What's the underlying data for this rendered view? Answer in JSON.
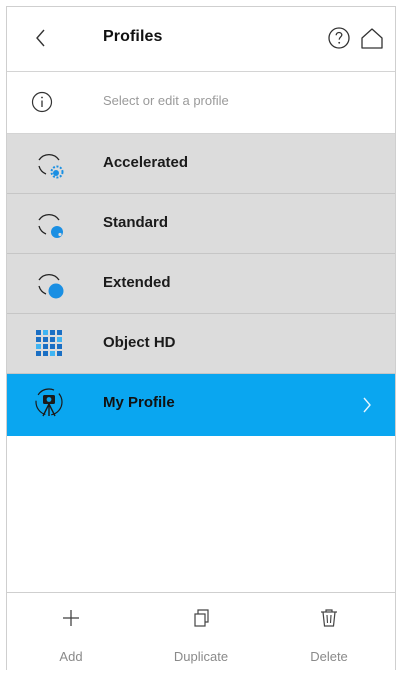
{
  "header": {
    "title": "Profiles",
    "back_icon": "chevron-left-icon",
    "help_icon": "help-circle-icon",
    "home_icon": "home-icon"
  },
  "info": {
    "icon": "info-icon",
    "text": "Select or edit a profile"
  },
  "profiles": [
    {
      "label": "Accelerated",
      "icon": "accelerated-profile-icon",
      "selected": false
    },
    {
      "label": "Standard",
      "icon": "standard-profile-icon",
      "selected": false
    },
    {
      "label": "Extended",
      "icon": "extended-profile-icon",
      "selected": false
    },
    {
      "label": "Object HD",
      "icon": "object-hd-grid-icon",
      "selected": false
    },
    {
      "label": "My Profile",
      "icon": "camera-tripod-icon",
      "selected": true
    }
  ],
  "toolbar": {
    "add_label": "Add",
    "duplicate_label": "Duplicate",
    "delete_label": "Delete"
  },
  "colors": {
    "selected_row": "#0aa6f0",
    "row": "#dcdcdc",
    "accent_blue": "#1a8fe3"
  }
}
